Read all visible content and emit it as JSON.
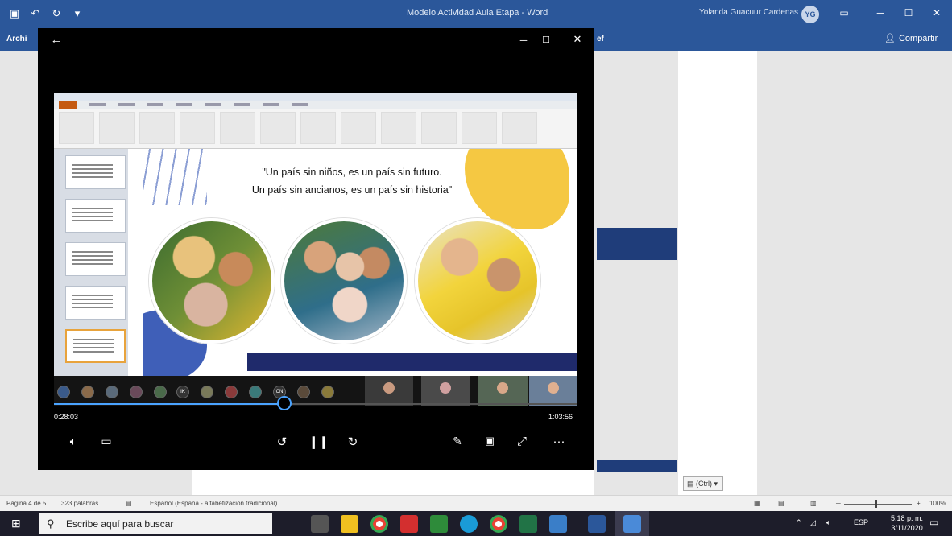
{
  "word": {
    "title": "Modelo Actividad Aula Etapa - Word",
    "user_name": "Yolanda Guacuur Cardenas",
    "user_initials": "YG",
    "tab_file": "Archi",
    "tab_partial": "ef",
    "share_label": "Compartir",
    "paste_label": "(Ctrl) ▾",
    "status": {
      "page": "Página 4 de 5",
      "words": "323 palabras",
      "language": "Español (España - alfabetización tradicional)",
      "zoom": "100%"
    }
  },
  "player": {
    "slide_quote_line1": "\"Un país sin niños, es un país sin futuro.",
    "slide_quote_line2": "Un país sin ancianos, es un país sin historia\"",
    "elapsed": "0:28:03",
    "duration": "1:03:56",
    "progress": 0.44,
    "participant_initials": [
      "IK",
      "CN"
    ]
  },
  "taskbar": {
    "search_placeholder": "Escribe aquí para buscar",
    "lang": "ESP",
    "time": "5:18 p. m.",
    "date": "3/11/2020"
  }
}
